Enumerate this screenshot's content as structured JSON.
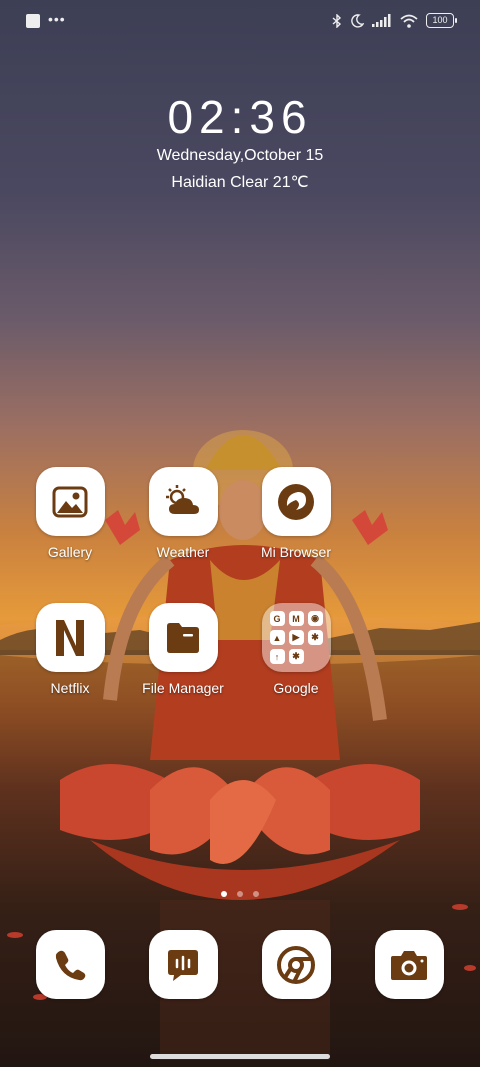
{
  "status_bar": {
    "battery": "100",
    "icons": [
      "notification-square-icon",
      "more-dots-icon",
      "bluetooth-icon",
      "moon-icon",
      "signal-icon",
      "wifi-icon",
      "battery-icon"
    ]
  },
  "lockclock": {
    "time": "02:36",
    "date": "Wednesday,October 15",
    "weather": "Haidian Clear 21℃"
  },
  "apps": [
    {
      "label": "Gallery",
      "icon": "gallery-icon"
    },
    {
      "label": "Weather",
      "icon": "weather-icon"
    },
    {
      "label": "Mi Browser",
      "icon": "browser-icon"
    },
    {
      "label": "Netflix",
      "icon": "netflix-icon"
    },
    {
      "label": "File Manager",
      "icon": "folder-icon"
    },
    {
      "label": "Google",
      "icon": "google-folder-icon"
    }
  ],
  "google_folder_letters": [
    "G",
    "M",
    "◉",
    "▲",
    "▶",
    "✱",
    "↑",
    "✱",
    ""
  ],
  "dock": [
    {
      "icon": "phone-icon"
    },
    {
      "icon": "messages-icon"
    },
    {
      "icon": "chrome-icon"
    },
    {
      "icon": "camera-icon"
    }
  ],
  "page_indicator": {
    "pages": 3,
    "active": 1
  },
  "colors": {
    "icon_brown": "#6b3b12",
    "icon_bg": "#ffffff"
  }
}
